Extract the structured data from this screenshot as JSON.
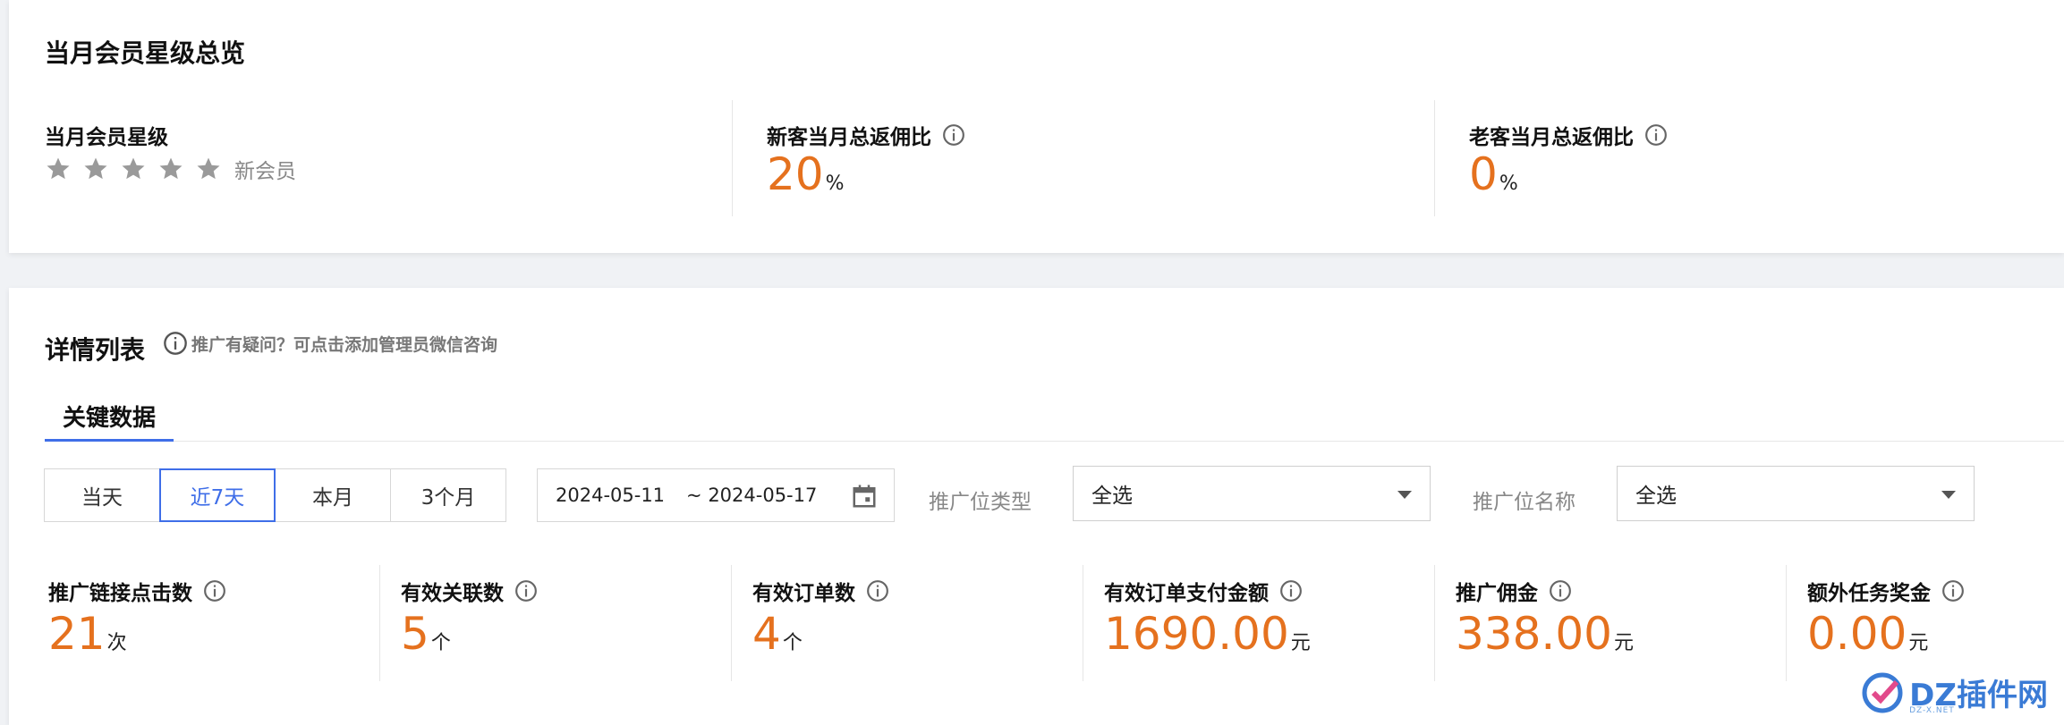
{
  "overview": {
    "title": "当月会员星级总览",
    "star_level": {
      "label": "当月会员星级",
      "stars": 5,
      "level_text": "新会员"
    },
    "new_customer_ratio": {
      "label": "新客当月总返佣比",
      "value": "20",
      "unit": "%"
    },
    "old_customer_ratio": {
      "label": "老客当月总返佣比",
      "value": "0",
      "unit": "%"
    }
  },
  "details": {
    "title": "详情列表",
    "hint": "推广有疑问？可点击添加管理员微信咨询",
    "tab": "关键数据",
    "ranges": [
      "当天",
      "近7天",
      "本月",
      "3个月"
    ],
    "active_range": "近7天",
    "date_start": "2024-05-11",
    "date_end": "~ 2024-05-17",
    "filter_type_label": "推广位类型",
    "filter_type_value": "全选",
    "filter_name_label": "推广位名称",
    "filter_name_value": "全选",
    "metrics": [
      {
        "label": "推广链接点击数",
        "value": "21",
        "unit": "次"
      },
      {
        "label": "有效关联数",
        "value": "5",
        "unit": "个"
      },
      {
        "label": "有效订单数",
        "value": "4",
        "unit": "个"
      },
      {
        "label": "有效订单支付金额",
        "value": "1690.00",
        "unit": "元"
      },
      {
        "label": "推广佣金",
        "value": "338.00",
        "unit": "元"
      },
      {
        "label": "额外任务奖金",
        "value": "0.00",
        "unit": "元"
      }
    ]
  },
  "watermark": {
    "text": "DZ插件网",
    "sub": "DZ-X.NET"
  },
  "colors": {
    "accent": "#e5711e",
    "primary": "#3f6ee8"
  }
}
